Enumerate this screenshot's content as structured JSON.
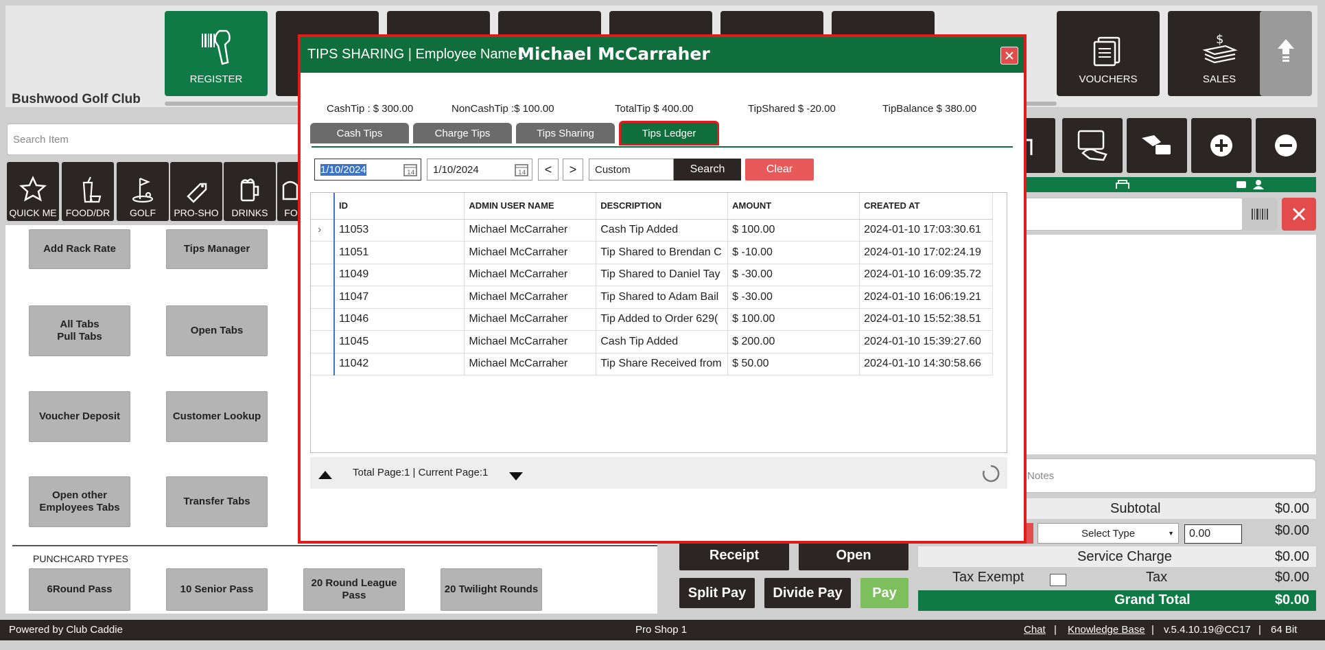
{
  "nav": {
    "tiles": [
      {
        "label": "REGISTER",
        "icon": "barcode-scanner-icon",
        "active": true
      },
      {
        "label": "",
        "icon": "nav-icon-2"
      },
      {
        "label": "",
        "icon": "nav-icon-3"
      },
      {
        "label": "",
        "icon": "nav-icon-4"
      },
      {
        "label": "",
        "icon": "nav-icon-5"
      },
      {
        "label": "",
        "icon": "nav-icon-6"
      },
      {
        "label": "",
        "icon": "nav-icon-7"
      },
      {
        "label": "VOUCHERS",
        "icon": "voucher-icon"
      },
      {
        "label": "SALES",
        "icon": "sales-money-icon"
      }
    ],
    "scroll_up_icon": "arrow-up-icon"
  },
  "club_name": "Bushwood Golf Club",
  "search_item": {
    "placeholder": "Search Item"
  },
  "categories": [
    {
      "label": "QUICK ME",
      "icon": "star-icon"
    },
    {
      "label": "FOOD/DR",
      "icon": "food-drink-icon"
    },
    {
      "label": "GOLF",
      "icon": "golf-icon"
    },
    {
      "label": "PRO-SHO",
      "icon": "tag-icon"
    },
    {
      "label": "DRINKS",
      "icon": "beer-icon"
    },
    {
      "label": "FO",
      "icon": "food-icon"
    }
  ],
  "functions": [
    {
      "label": "Add Rack Rate"
    },
    {
      "label": "Tips Manager"
    },
    {
      "label": "All Tabs\nPull Tabs"
    },
    {
      "label": "Open Tabs"
    },
    {
      "label": "Voucher Deposit"
    },
    {
      "label": "Customer Lookup"
    },
    {
      "label": "Open other\nEmployees Tabs"
    },
    {
      "label": "Transfer Tabs"
    }
  ],
  "punchcard": {
    "title": "PUNCHCARD TYPES",
    "items": [
      {
        "label": "6Round Pass"
      },
      {
        "label": "10 Senior Pass"
      },
      {
        "label": "20 Round League\nPass"
      },
      {
        "label": "20 Twilight Rounds"
      }
    ]
  },
  "right_panel": {
    "notes_placeholder": "Notes",
    "totals": {
      "subtotal_label": "Subtotal",
      "subtotal": "$0.00",
      "type_amount": "$0.00",
      "service_label": "Service Charge",
      "service": "$0.00",
      "tax_exempt_label": "Tax Exempt",
      "tax_label": "Tax",
      "tax": "$0.00",
      "grand_label": "Grand Total",
      "grand": "$0.00"
    },
    "select_type": "Select Type",
    "amount_value": "0.00",
    "buttons": {
      "receipt": "Receipt",
      "open": "Open",
      "split": "Split Pay",
      "divide": "Divide Pay",
      "pay": "Pay"
    }
  },
  "footer": {
    "powered": "Powered by Club Caddie",
    "location": "Pro Shop 1",
    "chat": "Chat",
    "sep": "|",
    "kb": "Knowledge Base",
    "version": "v.5.4.10.19@CC17",
    "bits": "64 Bit"
  },
  "modal": {
    "title": "TIPS SHARING  | Employee Name :",
    "employee": "Michael McCarraher",
    "summary": {
      "cash": "CashTip : $ 300.00",
      "noncash": "NonCashTip :$ 100.00",
      "total": "TotalTip $ 400.00",
      "shared": "TipShared $ -20.00",
      "balance": "TipBalance $ 380.00"
    },
    "tabs": [
      "Cash Tips",
      "Charge Tips",
      "Tips Sharing",
      "Tips Ledger"
    ],
    "filters": {
      "from": "1/10/2024",
      "to": "1/10/2024",
      "range": "Custom",
      "search": "Search",
      "clear": "Clear",
      "prev": "<",
      "next": ">"
    },
    "grid": {
      "columns": [
        "ID",
        "ADMIN USER NAME",
        "DESCRIPTION",
        "AMOUNT",
        "CREATED AT"
      ],
      "rows": [
        [
          "11053",
          "Michael McCarraher",
          "Cash Tip Added",
          "$ 100.00",
          "2024-01-10 17:03:30.61"
        ],
        [
          "11051",
          "Michael McCarraher",
          "Tip Shared to Brendan  C",
          "$ -10.00",
          "2024-01-10 17:02:24.19"
        ],
        [
          "11049",
          "Michael McCarraher",
          "Tip Shared to Daniel Tay",
          "$ -30.00",
          "2024-01-10 16:09:35.72"
        ],
        [
          "11047",
          "Michael McCarraher",
          "Tip Shared to Adam Bail",
          "$ -30.00",
          "2024-01-10 16:06:19.21"
        ],
        [
          "11046",
          "Michael McCarraher",
          "Tip Added to Order 629(",
          "$ 100.00",
          "2024-01-10 15:52:38.51"
        ],
        [
          "11045",
          "Michael McCarraher",
          "Cash Tip Added",
          "$ 200.00",
          "2024-01-10 15:39:27.60"
        ],
        [
          "11042",
          "Michael McCarraher",
          "Tip Share Received from",
          "$ 50.00",
          "2024-01-10 14:30:58.66"
        ]
      ],
      "row_indicator": "›"
    },
    "pager": {
      "text": "Total Page:1 |  Current Page:1"
    }
  }
}
